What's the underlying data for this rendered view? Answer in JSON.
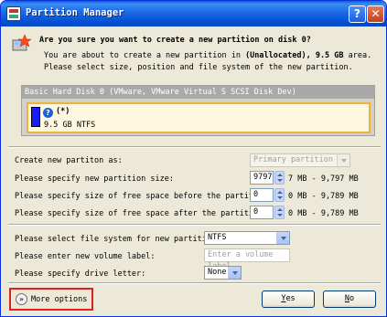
{
  "window": {
    "title": "Partition Manager",
    "help_glyph": "?",
    "close_glyph": "✕"
  },
  "prompt": {
    "question": "Are you sure you want to create a new partition on disk 0?",
    "desc_line1_prefix": "You are about to create a new partition in ",
    "desc_line1_bold": "(Unallocated), 9.5 GB",
    "desc_line1_suffix": " area.",
    "desc_line2": "Please select size, position and file system of the new partition."
  },
  "disk": {
    "header": "Basic Hard Disk 0 (VMware, VMware Virtual S SCSI Disk Dev)",
    "partition_name": "(*)",
    "partition_size": "9.5 GB NTFS",
    "partition_color": "#1a1aff"
  },
  "form": {
    "partition_type_label": "Create new partiton as:",
    "partition_type_value": "Primary partition",
    "size_label": "Please specify new partition size:",
    "size_value": "9797",
    "size_range": "7 MB - 9,797 MB",
    "before_label": "Please specify size of free space before the partition:",
    "before_value": "0",
    "before_range": "0 MB - 9,789 MB",
    "after_label": "Please specify size of free space after the partition:",
    "after_value": "0",
    "after_range": "0 MB - 9,789 MB",
    "fs_label": "Please select file system for new partition:",
    "fs_value": "NTFS",
    "volume_label": "Please enter new volume label:",
    "volume_placeholder": "Enter a volume label",
    "drive_label": "Please specify drive letter:",
    "drive_value": "None"
  },
  "footer": {
    "more_options": "More options",
    "more_icon": "»",
    "yes_key": "Y",
    "yes_rest": "es",
    "no_key": "N",
    "no_rest": "o"
  },
  "colors": {
    "titlebar": "#0550d6",
    "highlight_box": "#e0201c",
    "partition_border": "#f0b040"
  }
}
